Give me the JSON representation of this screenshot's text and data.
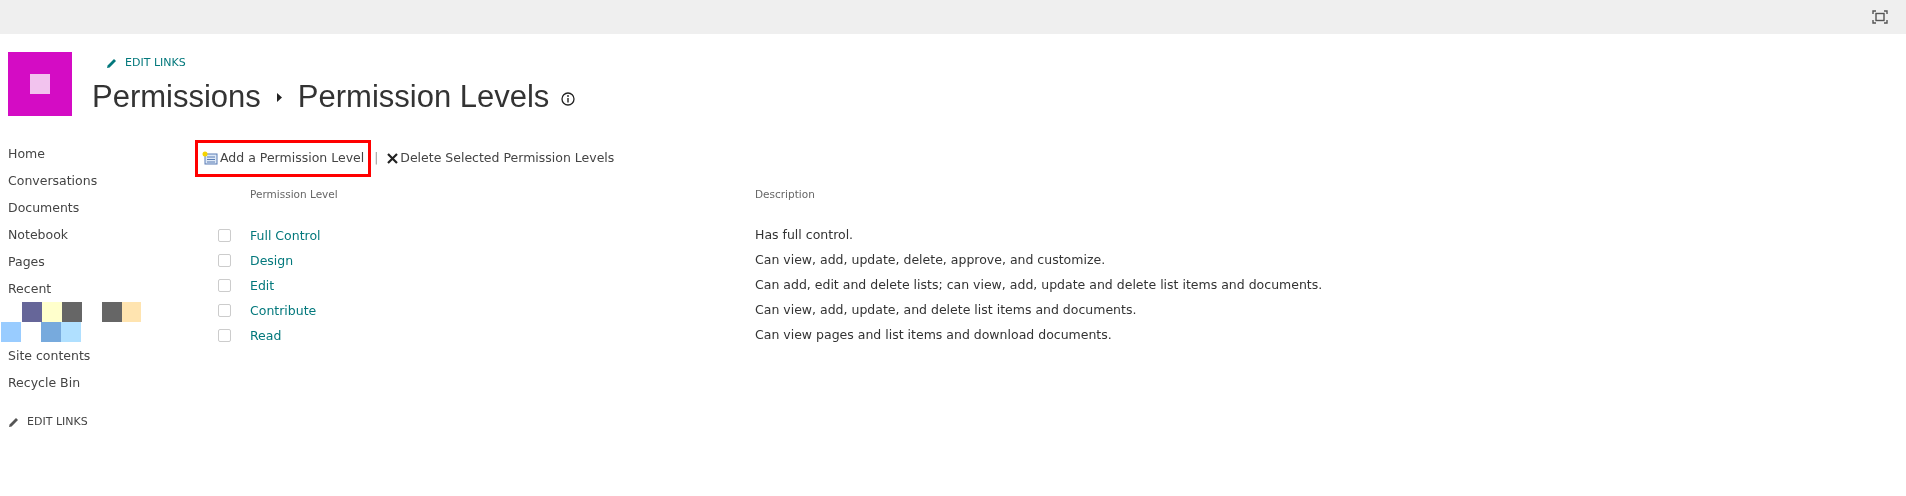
{
  "header": {
    "edit_links": "EDIT LINKS",
    "breadcrumb": [
      "Permissions",
      "Permission Levels"
    ]
  },
  "sidebar": {
    "items": [
      "Home",
      "Conversations",
      "Documents",
      "Notebook",
      "Pages",
      "Recent"
    ],
    "items_after": [
      "Site contents",
      "Recycle Bin"
    ],
    "edit_links": "EDIT LINKS"
  },
  "toolbar": {
    "add": {
      "label": "Add a Permission Level",
      "highlighted": true
    },
    "separator": "|",
    "delete": {
      "label": "Delete Selected Permission Levels"
    }
  },
  "table": {
    "columns": [
      "Permission Level",
      "Description"
    ],
    "rows": [
      {
        "name": "Full Control",
        "description": "Has full control.",
        "checked": false
      },
      {
        "name": "Design",
        "description": "Can view, add, update, delete, approve, and customize.",
        "checked": false
      },
      {
        "name": "Edit",
        "description": "Can add, edit and delete lists; can view, add, update and delete list items and documents.",
        "checked": false
      },
      {
        "name": "Contribute",
        "description": "Can view, add, update, and delete list items and documents.",
        "checked": false
      },
      {
        "name": "Read",
        "description": "Can view pages and list items and download documents.",
        "checked": false
      }
    ]
  }
}
